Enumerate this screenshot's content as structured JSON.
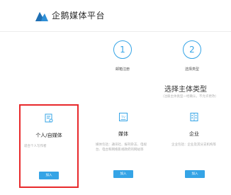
{
  "header": {
    "brand": "企鹅媒体平台"
  },
  "steps": [
    {
      "number": "1",
      "label": "邮箱注册"
    },
    {
      "number": "2",
      "label": "选择类型"
    }
  ],
  "main": {
    "title": "选择主体类型",
    "subtitle": "（注册主体类型一经确认，不允许更改）",
    "cards": [
      {
        "name": "个人/自媒体",
        "desc": "适合个人写作者",
        "button": "加入"
      },
      {
        "name": "媒体",
        "desc": "媒体包括：通讯社、报刊杂志、电视台、电台和网络影视政府的网站等",
        "button": "加入"
      },
      {
        "name": "企业",
        "desc": "企业包括：企业及其分支机构等",
        "button": "加入"
      }
    ]
  },
  "colors": {
    "accent": "#35a4e6",
    "selected_border": "#e8292b"
  }
}
